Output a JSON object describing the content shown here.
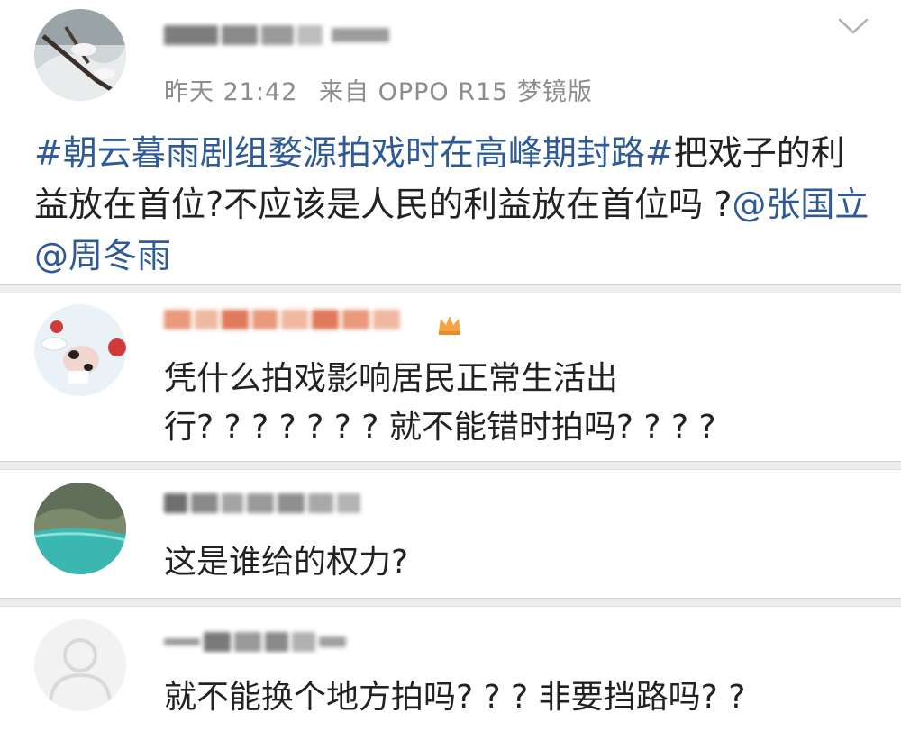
{
  "post": {
    "author_blurred": true,
    "timestamp": "昨天 21:42",
    "source": "来自 OPPO R15 梦镜版",
    "hashtag": "#朝云暮雨剧组婺源拍戏时在高峰期封路#",
    "body": "把戏子的利益放在首位?不应该是人民的利益放在首位吗 ?",
    "mentions": [
      "@张国立",
      " @周冬雨"
    ],
    "menu_icon": "chevron-down-icon"
  },
  "comments": [
    {
      "author_blurred": true,
      "line1": "凭什么拍戏影响居民正常生活出",
      "line2": "行? ? ? ? ? ? ? 就不能错时拍吗? ? ? ?"
    },
    {
      "author_blurred": true,
      "line1": "这是谁给的权力?"
    },
    {
      "author_blurred": true,
      "line1": "就不能换个地方拍吗? ? ? 非要挡路吗? ?"
    }
  ],
  "colors": {
    "link": "#2e5a97",
    "meta": "#8c8c8c",
    "separator": "#eeeeee"
  }
}
